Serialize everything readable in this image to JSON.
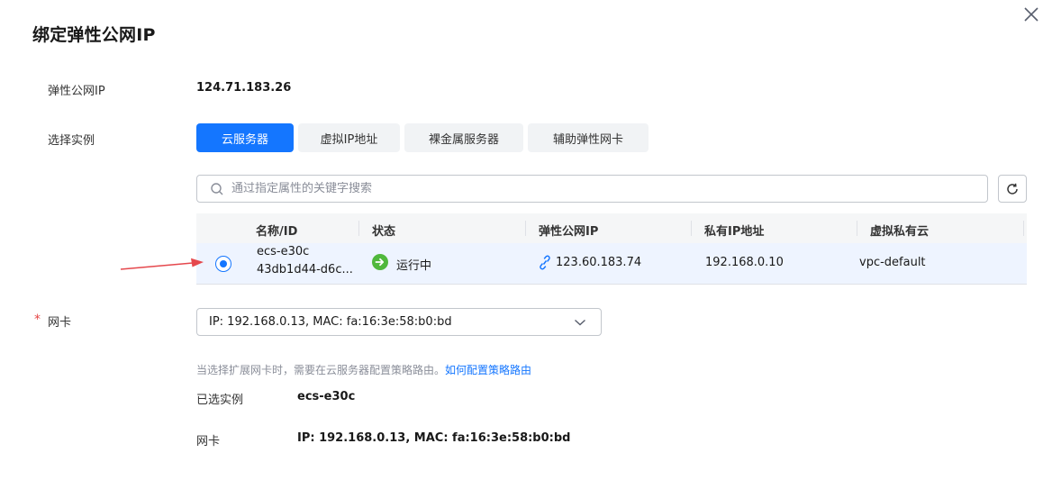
{
  "dialog": {
    "title": "绑定弹性公网IP"
  },
  "eip": {
    "label": "弹性公网IP",
    "value": "124.71.183.26"
  },
  "instance_select": {
    "label": "选择实例",
    "tabs": [
      "云服务器",
      "虚拟IP地址",
      "裸金属服务器",
      "辅助弹性网卡"
    ],
    "active_tab": "云服务器"
  },
  "search": {
    "placeholder": "通过指定属性的关键字搜索"
  },
  "table": {
    "columns": [
      "名称/ID",
      "状态",
      "弹性公网IP",
      "私有IP地址",
      "虚拟私有云"
    ],
    "rows": [
      {
        "name": "ecs-e30c",
        "id": "43db1d44-d6c...",
        "status": "运行中",
        "eip": "123.60.183.74",
        "private_ip": "192.168.0.10",
        "vpc": "vpc-default",
        "selected": true
      }
    ]
  },
  "nic": {
    "required_mark": "*",
    "label": "网卡",
    "value": "IP: 192.168.0.13, MAC: fa:16:3e:58:b0:bd"
  },
  "hint": {
    "text": "当选择扩展网卡时，需要在云服务器配置策略路由。",
    "link": "如何配置策略路由"
  },
  "summary": {
    "selected_instance_label": "已选实例",
    "selected_instance_value": "ecs-e30c",
    "nic_label": "网卡",
    "nic_value": "IP: 192.168.0.13, MAC: fa:16:3e:58:b0:bd"
  },
  "colors": {
    "accent": "#1476ff",
    "status_running": "#50b83c",
    "required": "#e54545",
    "annotation_arrow": "#e5484d"
  }
}
